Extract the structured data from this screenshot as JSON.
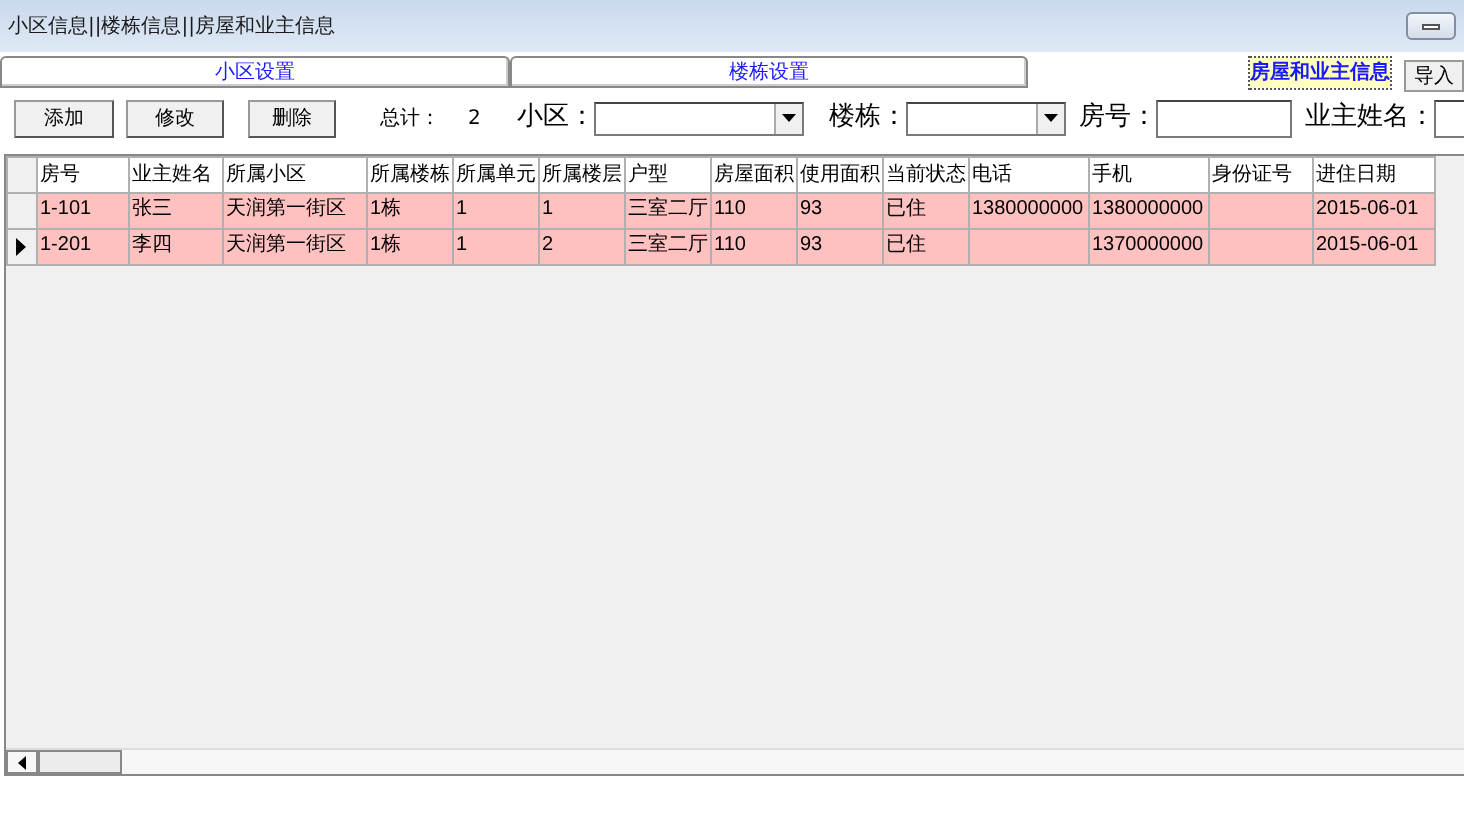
{
  "window": {
    "title": "小区信息||楼栋信息||房屋和业主信息"
  },
  "tabs": [
    {
      "label": "小区设置",
      "selected": false
    },
    {
      "label": "楼栋设置",
      "selected": false
    },
    {
      "label": "房屋和业主信息",
      "selected": true
    }
  ],
  "import_button": "导入",
  "toolbar": {
    "buttons": [
      "添加",
      "修改",
      "删除"
    ],
    "total_label": "总计：",
    "total": "2",
    "filters": [
      {
        "label": "小区：",
        "kind": "select"
      },
      {
        "label": "楼栋：",
        "kind": "select"
      },
      {
        "label": "房号：",
        "kind": "input"
      },
      {
        "label": "业主姓名：",
        "kind": "input"
      }
    ]
  },
  "table": {
    "columns": [
      "房号",
      "业主姓名",
      "所属小区",
      "所属楼栋",
      "所属单元",
      "所属楼层",
      "户型",
      "房屋面积",
      "使用面积",
      "当前状态",
      "电话",
      "手机",
      "身份证号",
      "进住日期"
    ],
    "rows": [
      {
        "selected": false,
        "cells": [
          "1-101",
          "张三",
          "天润第一街区",
          "1栋",
          "1",
          "1",
          "三室二厅",
          "110",
          "93",
          "已住",
          "1380000000",
          "1380000000",
          "",
          "2015-06-01"
        ]
      },
      {
        "selected": true,
        "cells": [
          "1-201",
          "李四",
          "天润第一街区",
          "1栋",
          "1",
          "2",
          "三室二厅",
          "110",
          "93",
          "已住",
          "",
          "1370000000",
          "",
          "2015-06-01"
        ]
      }
    ]
  }
}
